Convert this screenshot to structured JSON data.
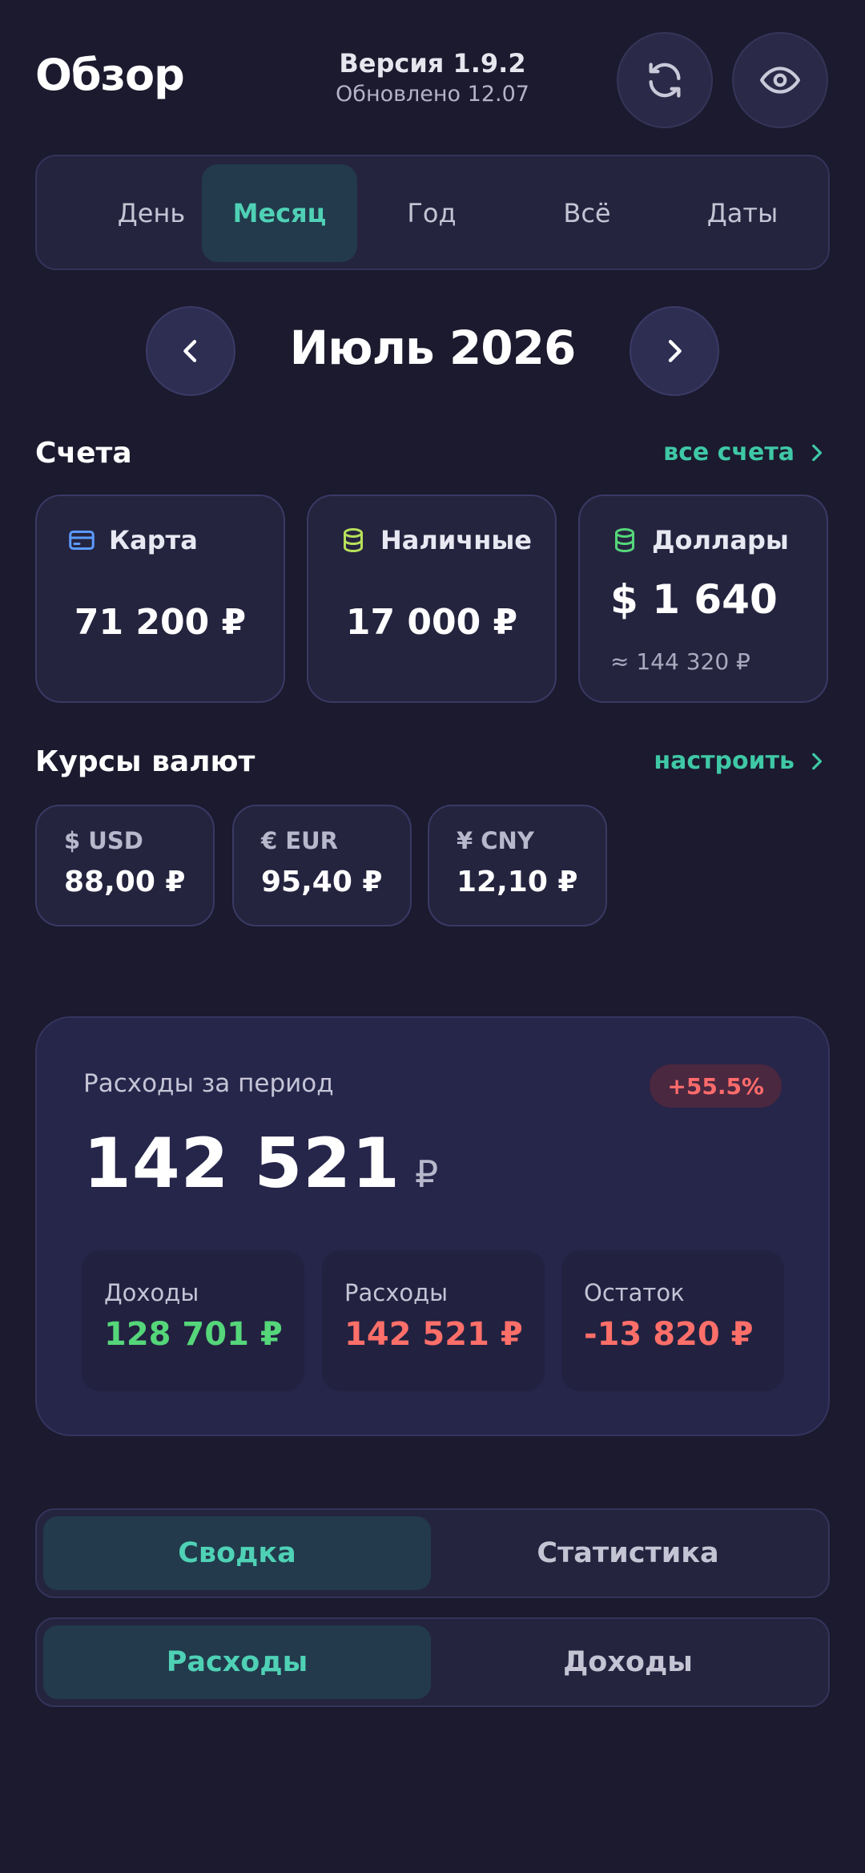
{
  "header": {
    "title": "Обзор",
    "version": "Версия 1.9.2",
    "updated": "Обновлено 12.07",
    "icons": [
      "refresh-icon",
      "eye-icon"
    ]
  },
  "period_tabs": [
    {
      "label": "День",
      "active": false
    },
    {
      "label": "Месяц",
      "active": true
    },
    {
      "label": "Год",
      "active": false
    },
    {
      "label": "Всё",
      "active": false
    },
    {
      "label": "Даты",
      "active": false
    }
  ],
  "month": "Июль 2026",
  "accounts": {
    "title": "Счета",
    "link": "все счета",
    "items": [
      {
        "name": "Карта",
        "amount": "71 200 ₽",
        "icon": "card-icon"
      },
      {
        "name": "Наличные",
        "amount": "17 000 ₽",
        "icon": "coins-icon"
      },
      {
        "name": "Доллары",
        "amount": "$ 1 640",
        "sub": "≈ 144 320 ₽",
        "icon": "coins-icon"
      }
    ]
  },
  "rates": {
    "title": "Курсы валют",
    "link": "настроить",
    "items": [
      {
        "code": "$ USD",
        "rate": "88,00 ₽"
      },
      {
        "code": "€ EUR",
        "rate": "95,40 ₽"
      },
      {
        "code": "¥ CNY",
        "rate": "12,10 ₽"
      }
    ]
  },
  "summary": {
    "label": "Расходы за период",
    "badge": "+55.5%",
    "total": "142 521",
    "currency": "₽",
    "stats": [
      {
        "label": "Доходы",
        "value": "128 701 ₽"
      },
      {
        "label": "Расходы",
        "value": "142 521 ₽"
      },
      {
        "label": "Остаток",
        "value": "-13 820 ₽"
      }
    ]
  },
  "view_toggle": {
    "options": [
      "Сводка",
      "Статистика"
    ],
    "active": 0
  },
  "type_toggle": {
    "options": [
      "Расходы",
      "Доходы"
    ],
    "active": 0
  },
  "colors": {
    "background": "#1b1a2e",
    "accent": "#4fd1b5",
    "income": "#55d67a",
    "expense": "#ff6f69",
    "card_icon": "#5b9bff",
    "coins_icon_1": "#b6e05a",
    "coins_icon_2": "#55d67a"
  }
}
